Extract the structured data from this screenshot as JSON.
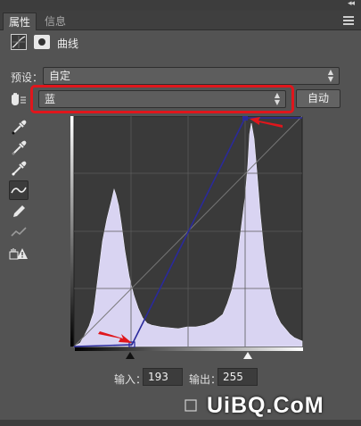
{
  "tabs": [
    {
      "label": "属性",
      "active": true
    },
    {
      "label": "信息",
      "active": false
    }
  ],
  "panel": {
    "title": "曲线",
    "collapse_glyph": "◂◂",
    "close_glyph": "✕"
  },
  "preset": {
    "label": "预设：",
    "value": "自定"
  },
  "channel": {
    "value": "蓝",
    "auto_label": "自动",
    "highlight_color": "#e0161c"
  },
  "tools": [
    {
      "icon": "on-image-adjust-icon"
    },
    {
      "icon": "black-point-eyedropper-icon"
    },
    {
      "icon": "gray-point-eyedropper-icon"
    },
    {
      "icon": "white-point-eyedropper-icon"
    },
    {
      "icon": "curve-edit-points-icon",
      "selected": true
    },
    {
      "icon": "pencil-draw-icon"
    },
    {
      "icon": "smooth-curve-icon"
    },
    {
      "icon": "clipping-warning-icon"
    }
  ],
  "curves": {
    "histogram_color": "#d9d4f2",
    "curve_color": "#2a2a9c",
    "arrow_color": "#e0161c",
    "input_black": 0,
    "input_white": 193,
    "output_white": 255
  },
  "io": {
    "input_label": "输入：",
    "input_value": "193",
    "output_label": "输出：",
    "output_value": "255"
  },
  "watermark": {
    "text": "UiBQ.CoM"
  }
}
